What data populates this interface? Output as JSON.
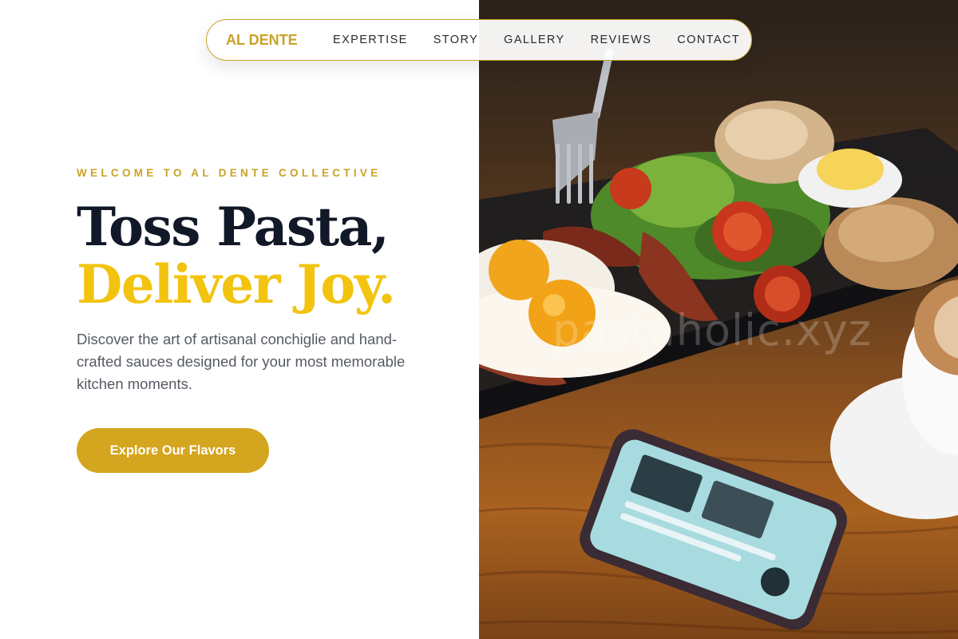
{
  "nav": {
    "brand": "AL DENTE",
    "links": [
      "EXPERTISE",
      "STORY",
      "GALLERY",
      "REVIEWS",
      "CONTACT"
    ]
  },
  "hero": {
    "eyebrow": "WELCOME TO AL DENTE COLLECTIVE",
    "headline_line1": "Toss Pasta,",
    "headline_line2": "Deliver Joy.",
    "description": "Discover the art of artisanal conchiglie and hand-crafted sauces designed for your most memorable kitchen moments.",
    "cta_label": "Explore Our Flavors",
    "image_watermark": "pastaholic.xyz"
  },
  "colors": {
    "accent_gold": "#c9a227",
    "headline_dark": "#111827",
    "headline_yellow": "#f2c40f",
    "cta_background": "#d4a51e"
  }
}
